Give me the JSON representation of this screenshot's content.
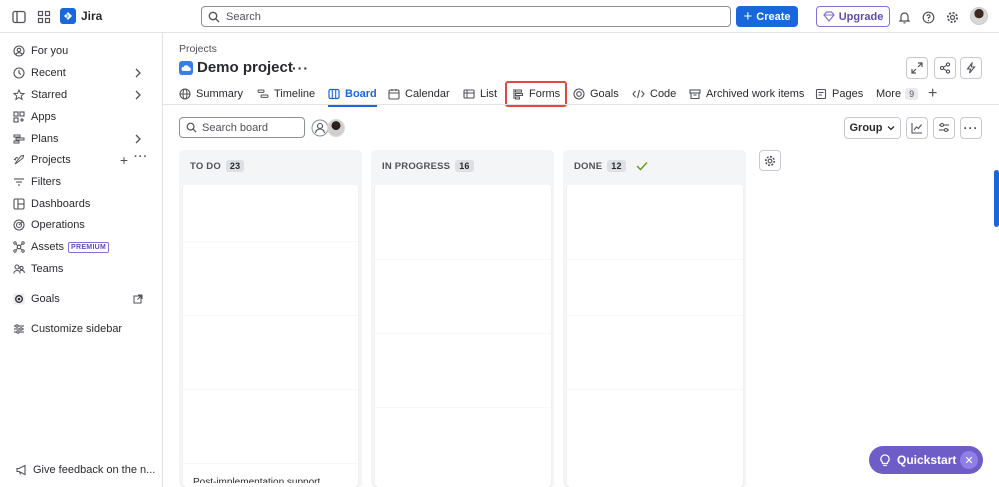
{
  "app": {
    "name": "Jira"
  },
  "topbar": {
    "search_placeholder": "Search",
    "create_label": "Create",
    "upgrade_label": "Upgrade"
  },
  "sidebar": {
    "items": [
      {
        "label": "For you",
        "icon": "user-circle-icon"
      },
      {
        "label": "Recent",
        "icon": "clock-icon",
        "chevron": true
      },
      {
        "label": "Starred",
        "icon": "star-icon",
        "chevron": true
      },
      {
        "label": "Apps",
        "icon": "apps-icon"
      },
      {
        "label": "Plans",
        "icon": "plans-icon",
        "chevron": true
      },
      {
        "label": "Projects",
        "icon": "rocket-icon"
      },
      {
        "label": "Filters",
        "icon": "filter-icon"
      },
      {
        "label": "Dashboards",
        "icon": "dashboard-icon"
      },
      {
        "label": "Operations",
        "icon": "operations-icon"
      },
      {
        "label": "Assets",
        "icon": "assets-icon",
        "badge": "PREMIUM"
      },
      {
        "label": "Teams",
        "icon": "teams-icon"
      },
      {
        "label": "Goals",
        "icon": "goals-icon"
      },
      {
        "label": "Customize sidebar",
        "icon": "customize-icon"
      }
    ],
    "feedback_label": "Give feedback on the n..."
  },
  "header": {
    "breadcrumb": "Projects",
    "title": "Demo project"
  },
  "tabs": [
    {
      "label": "Summary",
      "icon": "globe-icon"
    },
    {
      "label": "Timeline",
      "icon": "timeline-icon"
    },
    {
      "label": "Board",
      "icon": "board-icon",
      "active": true
    },
    {
      "label": "Calendar",
      "icon": "calendar-icon"
    },
    {
      "label": "List",
      "icon": "list-icon"
    },
    {
      "label": "Forms",
      "icon": "forms-icon",
      "highlighted": true
    },
    {
      "label": "Goals",
      "icon": "goals-icon"
    },
    {
      "label": "Code",
      "icon": "code-icon"
    },
    {
      "label": "Archived work items",
      "icon": "archive-icon"
    },
    {
      "label": "Pages",
      "icon": "pages-icon"
    },
    {
      "label": "More",
      "badge": "9"
    }
  ],
  "toolbar": {
    "search_placeholder": "Search board",
    "group_label": "Group"
  },
  "columns": [
    {
      "title": "TO DO",
      "count": "23"
    },
    {
      "title": "IN PROGRESS",
      "count": "16"
    },
    {
      "title": "DONE",
      "count": "12",
      "done": true
    }
  ],
  "board": {
    "partial_card_text": "Post-implementation support"
  },
  "quickstart": {
    "label": "Quickstart"
  },
  "colors": {
    "accent": "#1868db",
    "upgrade": "#5e4db2",
    "quickstart": "#6e5dc6",
    "highlight": "#e2483d"
  }
}
